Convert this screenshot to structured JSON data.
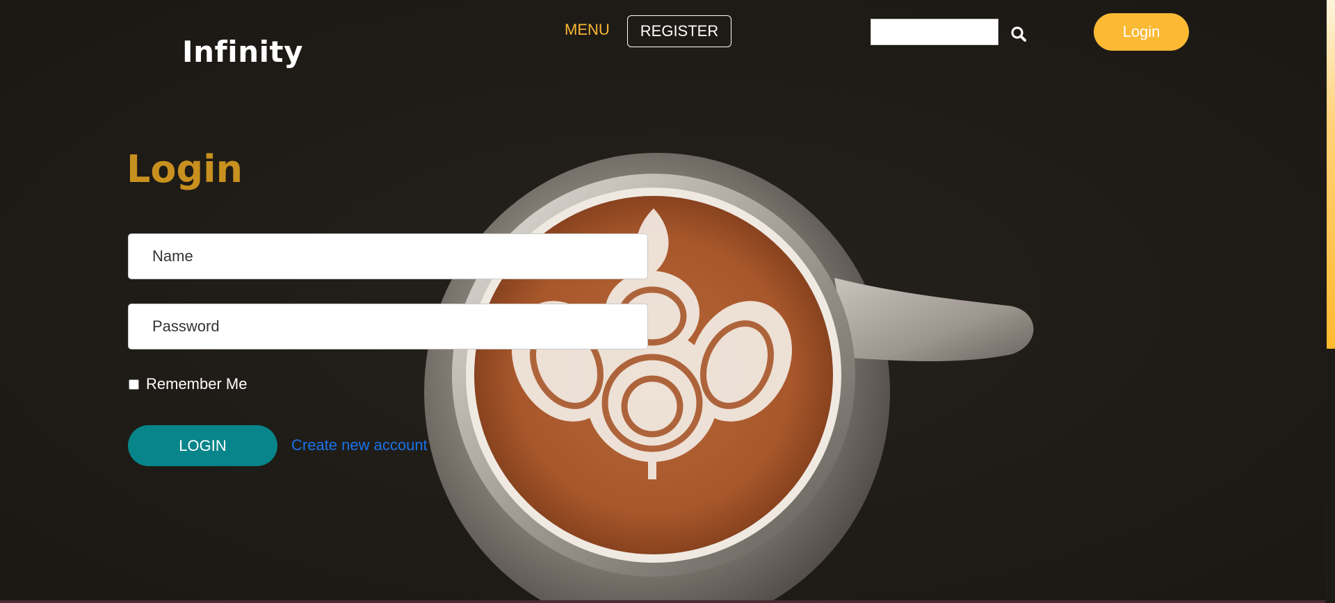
{
  "brand": {
    "logo_text": "Infinity"
  },
  "nav": {
    "menu_label": "MENU",
    "register_label": "REGISTER",
    "search": {
      "value": "",
      "placeholder": ""
    },
    "search_icon": "search-icon",
    "login_label": "Login"
  },
  "form": {
    "title": "Login",
    "name_placeholder": "Name",
    "password_placeholder": "Password",
    "remember_label": "Remember Me",
    "remember_checked": false,
    "submit_label": "LOGIN",
    "create_account_label": "Create new account"
  },
  "colors": {
    "background": "#1e1b17",
    "accent": "#fbb934",
    "menu_text": "#f7b733",
    "title": "#c8901e",
    "primary_button": "#07858a",
    "link": "#1a73e8"
  }
}
